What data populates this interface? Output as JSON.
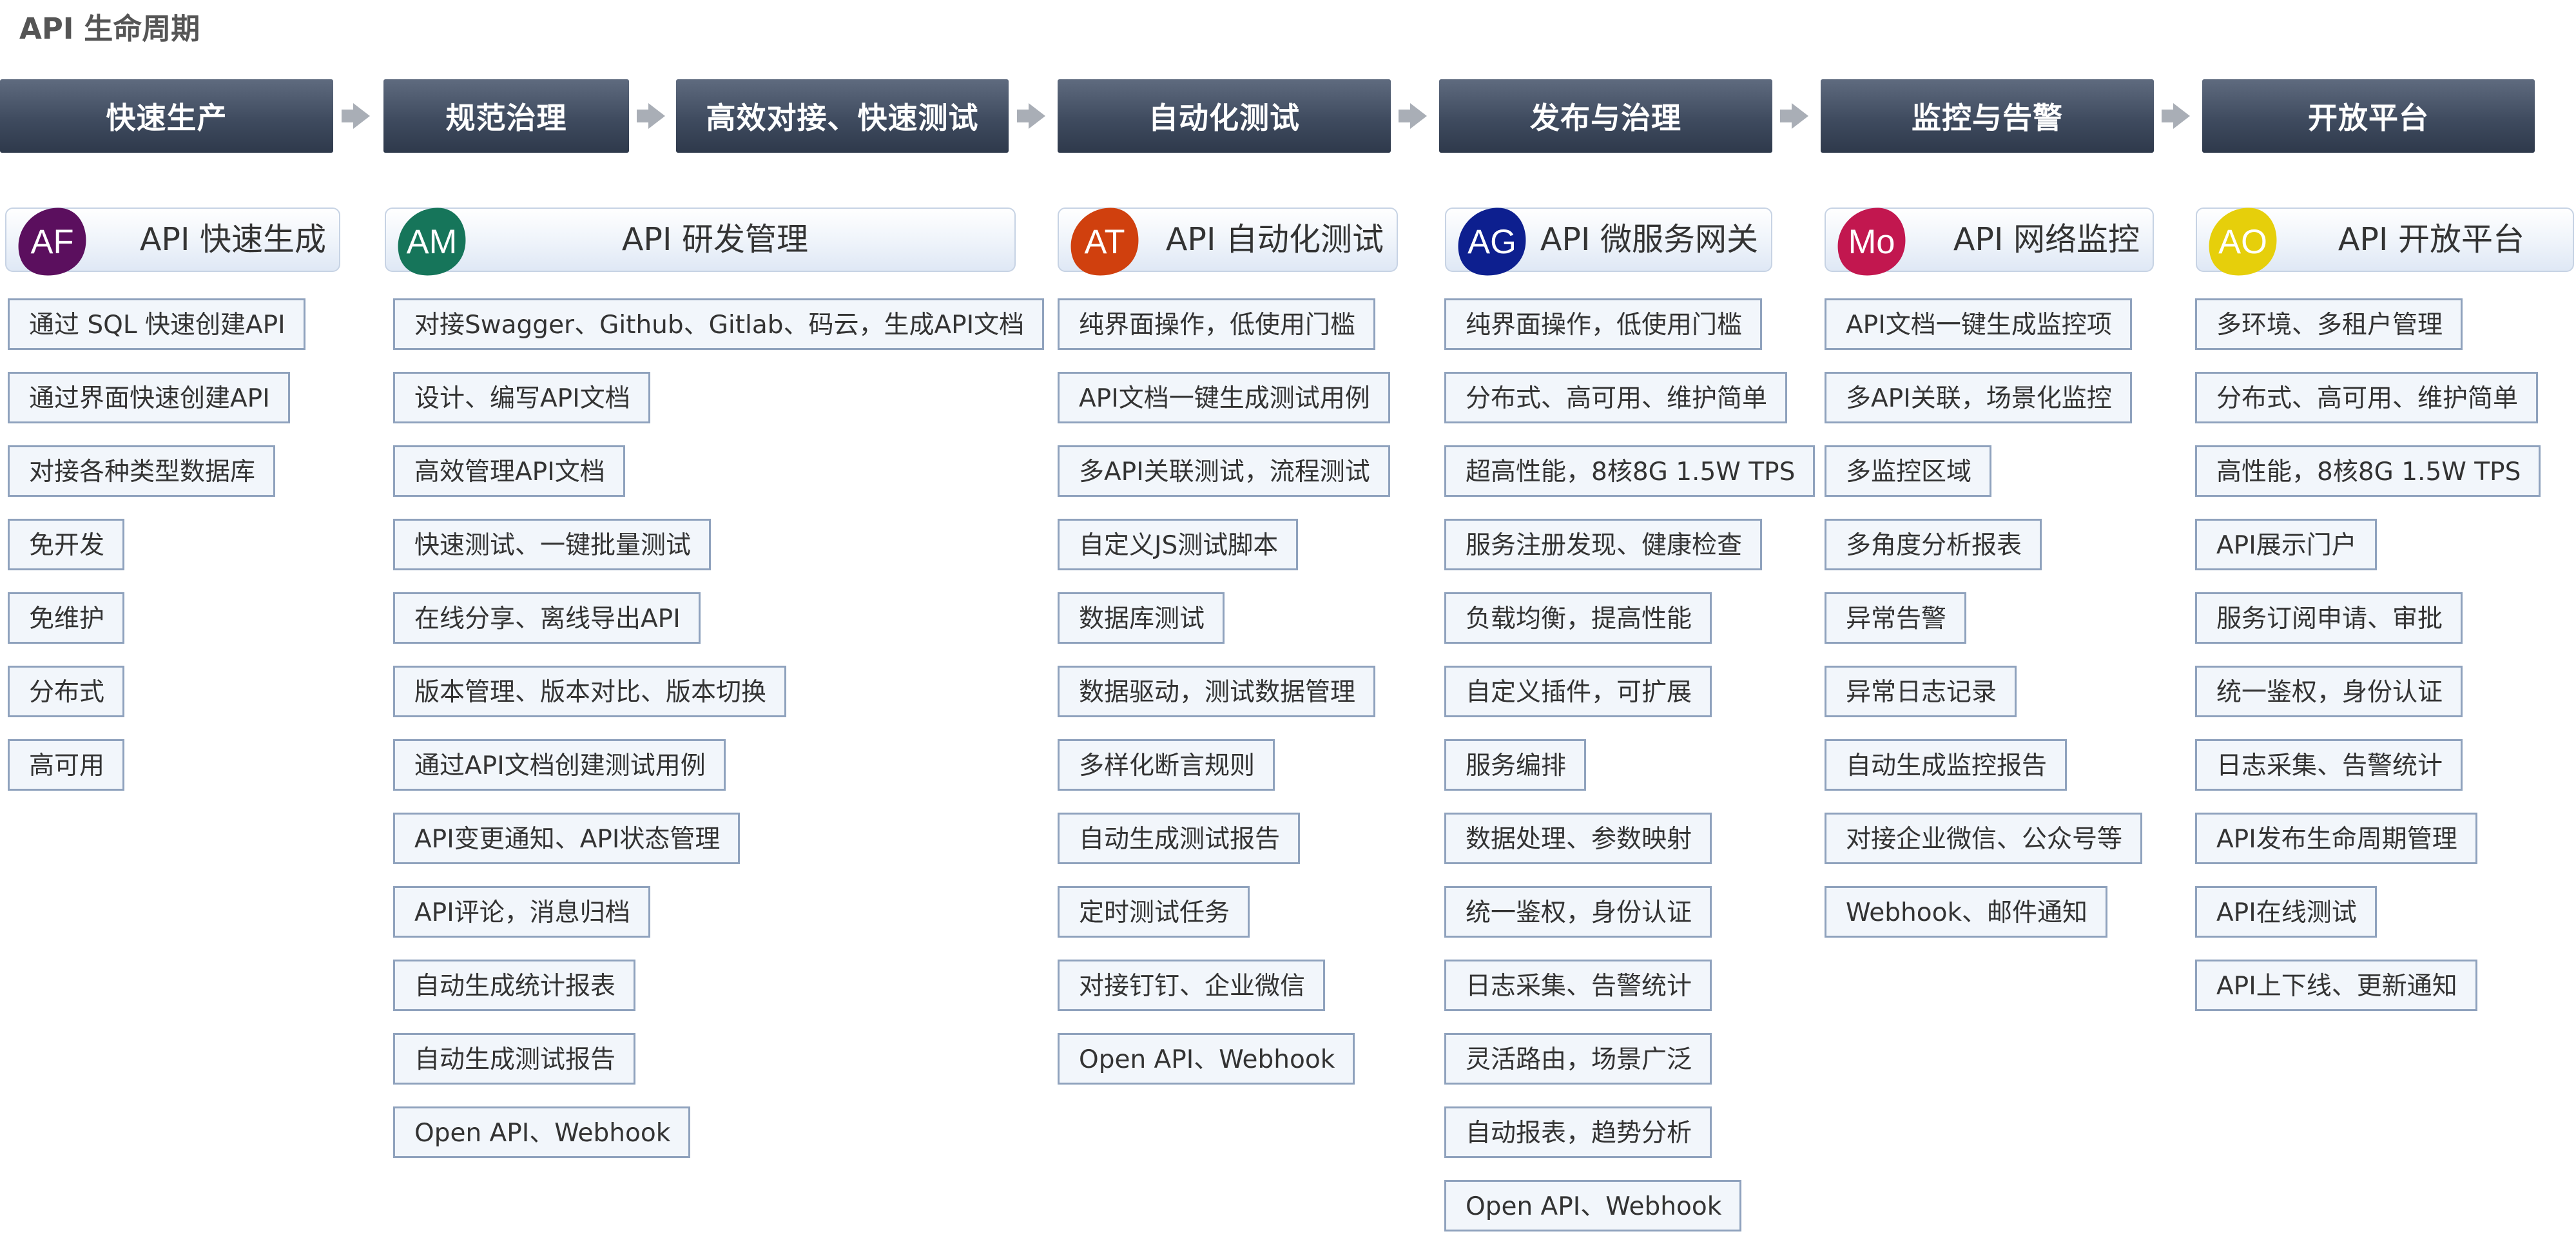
{
  "title": "API 生命周期",
  "stages": [
    {
      "label": "快速生产"
    },
    {
      "label": "规范治理"
    },
    {
      "label": "高效对接、快速测试"
    },
    {
      "label": "自动化测试"
    },
    {
      "label": "发布与治理"
    },
    {
      "label": "监控与告警"
    },
    {
      "label": "开放平台"
    }
  ],
  "products": [
    {
      "name": "API 快速生成",
      "logo_text": "AF",
      "color": "#5b0f5e",
      "features": [
        "通过 SQL 快速创建API",
        "通过界面快速创建API",
        "对接各种类型数据库",
        "免开发",
        "免维护",
        "分布式",
        "高可用"
      ]
    },
    {
      "name": "API 研发管理",
      "logo_text": "AM",
      "color": "#16755a",
      "features": [
        "对接Swagger、Github、Gitlab、码云，生成API文档",
        "设计、编写API文档",
        "高效管理API文档",
        "快速测试、一键批量测试",
        "在线分享、离线导出API",
        "版本管理、版本对比、版本切换",
        "通过API文档创建测试用例",
        "API变更通知、API状态管理",
        "API评论，消息归档",
        "自动生成统计报表",
        "自动生成测试报告",
        "Open API、Webhook"
      ]
    },
    {
      "name": "API 自动化测试",
      "logo_text": "AT",
      "color": "#d0400e",
      "features": [
        "纯界面操作，低使用门槛",
        "API文档一键生成测试用例",
        "多API关联测试，流程测试",
        "自定义JS测试脚本",
        "数据库测试",
        "数据驱动，测试数据管理",
        "多样化断言规则",
        "自动生成测试报告",
        "定时测试任务",
        "对接钉钉、企业微信",
        "Open API、Webhook"
      ]
    },
    {
      "name": "API 微服务网关",
      "logo_text": "AG",
      "color": "#0d1f8f",
      "features": [
        "纯界面操作，低使用门槛",
        "分布式、高可用、维护简单",
        "超高性能，8核8G 1.5W TPS",
        "服务注册发现、健康检查",
        "负载均衡，提高性能",
        "自定义插件，可扩展",
        "服务编排",
        "数据处理、参数映射",
        "统一鉴权，身份认证",
        "日志采集、告警统计",
        "灵活路由，场景广泛",
        "自动报表，趋势分析",
        "Open API、Webhook"
      ]
    },
    {
      "name": "API 网络监控",
      "logo_text": "Mo",
      "color": "#c2174f",
      "features": [
        "API文档一键生成监控项",
        "多API关联，场景化监控",
        "多监控区域",
        "多角度分析报表",
        "异常告警",
        "异常日志记录",
        "自动生成监控报告",
        "对接企业微信、公众号等",
        "Webhook、邮件通知"
      ]
    },
    {
      "name": "API 开放平台",
      "logo_text": "AO",
      "color": "#e6cf0b",
      "features": [
        "多环境、多租户管理",
        "分布式、高可用、维护简单",
        "高性能，8核8G 1.5W TPS",
        "API展示门户",
        "服务订阅申请、审批",
        "统一鉴权，身份认证",
        "日志采集、告警统计",
        "API发布生命周期管理",
        "API在线测试",
        "API上下线、更新通知"
      ]
    }
  ]
}
